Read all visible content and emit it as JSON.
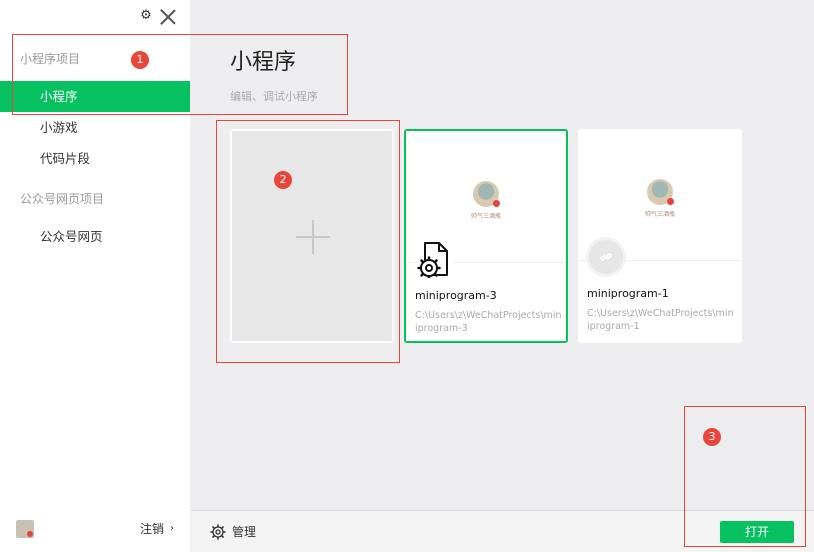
{
  "sidebar": {
    "section_miniprogram": "小程序项目",
    "items": [
      {
        "label": "小程序"
      },
      {
        "label": "小游戏"
      },
      {
        "label": "代码片段"
      }
    ],
    "section_official": "公众号网页项目",
    "official_items": [
      {
        "label": "公众号网页"
      }
    ],
    "logout_label": "注销",
    "logout_chevron": "›"
  },
  "main": {
    "title": "小程序",
    "subtitle": "编辑、调试小程序"
  },
  "projects": [
    {
      "name": "miniprogram-3",
      "path": "C:\\Users\\z\\WeChatProjects\\miniprogram-3",
      "thumb_caption": "帅气三酒瓶",
      "selected": true
    },
    {
      "name": "miniprogram-1",
      "path": "C:\\Users\\z\\WeChatProjects\\miniprogram-1",
      "thumb_caption": "帅气三酒瓶",
      "selected": false
    }
  ],
  "bottombar": {
    "manage_label": "管理",
    "open_label": "打开"
  },
  "annotations": [
    {
      "label": "1"
    },
    {
      "label": "2"
    },
    {
      "label": "3"
    }
  ],
  "colors": {
    "accent": "#07c160",
    "annotation": "#e8453c",
    "background": "#eeeef0"
  },
  "icons": [
    "settings-icon",
    "close-icon",
    "plus-icon",
    "gear-file-icon",
    "miniprogram-link-icon",
    "chevron-right-icon",
    "manage-gear-icon"
  ]
}
